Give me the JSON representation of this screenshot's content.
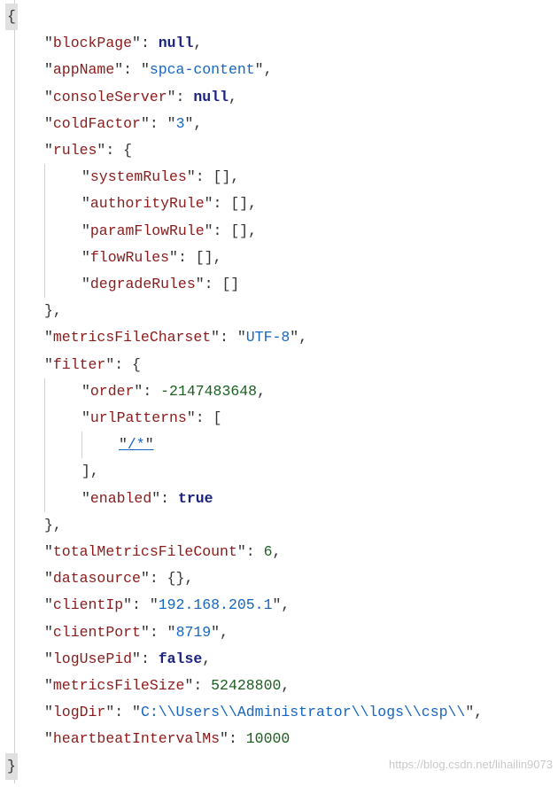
{
  "code": {
    "keys": {
      "blockPage": "blockPage",
      "appName": "appName",
      "consoleServer": "consoleServer",
      "coldFactor": "coldFactor",
      "rules": "rules",
      "systemRules": "systemRules",
      "authorityRule": "authorityRule",
      "paramFlowRule": "paramFlowRule",
      "flowRules": "flowRules",
      "degradeRules": "degradeRules",
      "metricsFileCharset": "metricsFileCharset",
      "filter": "filter",
      "order": "order",
      "urlPatterns": "urlPatterns",
      "enabled": "enabled",
      "totalMetricsFileCount": "totalMetricsFileCount",
      "datasource": "datasource",
      "clientIp": "clientIp",
      "clientPort": "clientPort",
      "logUsePid": "logUsePid",
      "metricsFileSize": "metricsFileSize",
      "logDir": "logDir",
      "heartbeatIntervalMs": "heartbeatIntervalMs"
    },
    "values": {
      "null": "null",
      "true": "true",
      "false": "false",
      "appName": "spca-content",
      "coldFactor": "3",
      "metricsFileCharset": "UTF-8",
      "order": "-2147483648",
      "urlPattern0": "/*",
      "totalMetricsFileCount": "6",
      "clientIp": "192.168.205.1",
      "clientPort": "8719",
      "metricsFileSize": "52428800",
      "logDir": "C:\\\\Users\\\\Administrator\\\\logs\\\\csp\\\\",
      "heartbeatIntervalMs": "10000"
    },
    "punct": {
      "openBrace": "{",
      "closeBrace": "}",
      "openBracket": "[",
      "closeBracket": "]",
      "colon": ":",
      "comma": ",",
      "quote": "\"",
      "emptyArray": "[]",
      "emptyObject": "{}"
    }
  },
  "watermark": "https://blog.csdn.net/lihailin9073"
}
